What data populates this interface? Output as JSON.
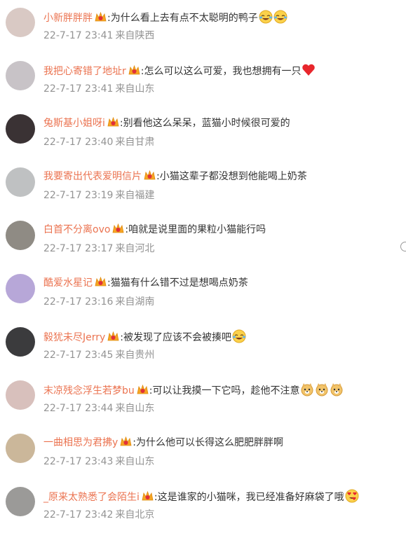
{
  "comments": [
    {
      "username": "小新胖胖胖",
      "text": ":为什么看上去有点不太聪明的鸭子",
      "emojis": [
        "laugh-cry-emoji",
        "laugh-cry-emoji"
      ],
      "time": "22-7-17 23:41",
      "location": "来自陕西",
      "avatar_color": "#d9c9c4"
    },
    {
      "username": "我把心寄错了地址r",
      "text": ":怎么可以这么可爱，我也想拥有一只",
      "emojis": [
        "red-heart-emoji"
      ],
      "time": "22-7-17 23:41",
      "location": "来自山东",
      "avatar_color": "#c8c3c7"
    },
    {
      "username": "兔斯基小姐呀i",
      "text": ":别看他这么呆呆，蓝猫小时候很可爱的",
      "emojis": [],
      "time": "22-7-17 23:40",
      "location": "来自甘肃",
      "avatar_color": "#3a3234"
    },
    {
      "username": "我要寄出代表爱明信片",
      "text": ":小猫这辈子都没想到他能喝上奶茶",
      "emojis": [],
      "time": "22-7-17 23:19",
      "location": "来自福建",
      "avatar_color": "#bfc1c2"
    },
    {
      "username": "白首不分离ovo",
      "text": ":咱就是说里面的果粒小猫能行吗",
      "emojis": [],
      "time": "22-7-17 23:17",
      "location": "来自河北",
      "avatar_color": "#8f8b84"
    },
    {
      "username": "酷爱水星记",
      "text": ":猫猫有什么错不过是想喝点奶茶",
      "emojis": [],
      "time": "22-7-17 23:16",
      "location": "来自湖南",
      "avatar_color": "#b7a7d8"
    },
    {
      "username": "毅犹未尽Jerry",
      "text": ":被发现了应该不会被揍吧",
      "emojis": [
        "laugh-cry-emoji"
      ],
      "time": "22-7-17 23:45",
      "location": "来自贵州",
      "avatar_color": "#3b3b3d"
    },
    {
      "username": "末凉残念浮生若梦bu",
      "text": ":可以让我摸一下它吗，趁他不注意",
      "emojis": [
        "doge-emoji",
        "doge-emoji",
        "doge-emoji"
      ],
      "time": "22-7-17 23:44",
      "location": "来自山东",
      "avatar_color": "#d8c0bc"
    },
    {
      "username": "一曲相思为君拂y",
      "text": ":为什么他可以长得这么肥肥胖胖啊",
      "emojis": [],
      "time": "22-7-17 23:43",
      "location": "来自山东",
      "avatar_color": "#cbb79a"
    },
    {
      "username": "_原来太熟悉了会陌生i",
      "text": ":这是谁家的小猫咪，我已经准备好麻袋了哦",
      "emojis": [
        "heart-eyes-emoji"
      ],
      "time": "22-7-17 23:42",
      "location": "来自北京",
      "avatar_color": "#9b9a98"
    }
  ],
  "colors": {
    "username": "#eb7350",
    "meta": "#939393",
    "text": "#333333"
  }
}
